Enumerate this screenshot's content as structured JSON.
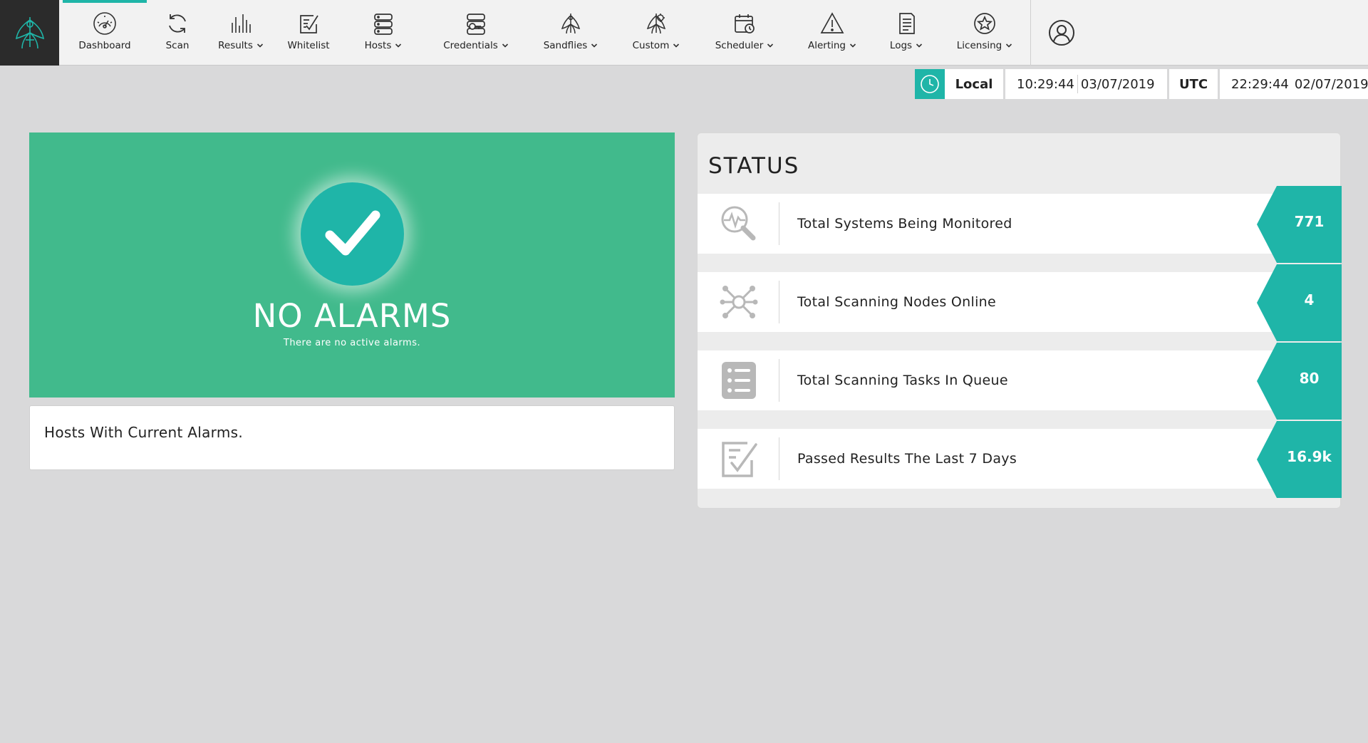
{
  "nav": {
    "items": [
      {
        "label": "Dashboard",
        "icon": "gauge-icon",
        "dropdown": false,
        "active": true
      },
      {
        "label": "Scan",
        "icon": "refresh-icon",
        "dropdown": false
      },
      {
        "label": "Results",
        "icon": "bars-icon",
        "dropdown": true
      },
      {
        "label": "Whitelist",
        "icon": "checklist-icon",
        "dropdown": false
      },
      {
        "label": "Hosts",
        "icon": "servers-icon",
        "dropdown": true
      },
      {
        "label": "Credentials",
        "icon": "credentials-icon",
        "dropdown": true
      },
      {
        "label": "Sandflies",
        "icon": "sandfly-icon",
        "dropdown": true
      },
      {
        "label": "Custom",
        "icon": "custom-sandfly-icon",
        "dropdown": true
      },
      {
        "label": "Scheduler",
        "icon": "calendar-clock-icon",
        "dropdown": true
      },
      {
        "label": "Alerting",
        "icon": "warning-icon",
        "dropdown": true
      },
      {
        "label": "Logs",
        "icon": "document-icon",
        "dropdown": true
      },
      {
        "label": "Licensing",
        "icon": "star-badge-icon",
        "dropdown": true
      }
    ]
  },
  "clock": {
    "local_label": "Local",
    "local_time": "10:29:44",
    "local_date": "03/07/2019",
    "utc_label": "UTC",
    "utc_time": "22:29:44",
    "utc_date": "02/07/2019"
  },
  "alarm": {
    "title": "NO ALARMS",
    "subtitle": "There are no active alarms."
  },
  "hosts_panel": {
    "title": "Hosts With Current Alarms."
  },
  "status": {
    "title": "STATUS",
    "rows": [
      {
        "label": "Total Systems Being Monitored",
        "value": "771",
        "icon": "monitor-search-icon"
      },
      {
        "label": "Total Scanning Nodes Online",
        "value": "4",
        "icon": "network-nodes-icon"
      },
      {
        "label": "Total Scanning Tasks In Queue",
        "value": "80",
        "icon": "task-list-icon"
      },
      {
        "label": "Passed Results The Last 7 Days",
        "value": "16.9k",
        "icon": "passed-check-icon"
      }
    ]
  },
  "colors": {
    "accent": "#1fb5a8",
    "alarm_green": "#41ba8c",
    "logo_bg": "#2b2b2b"
  }
}
